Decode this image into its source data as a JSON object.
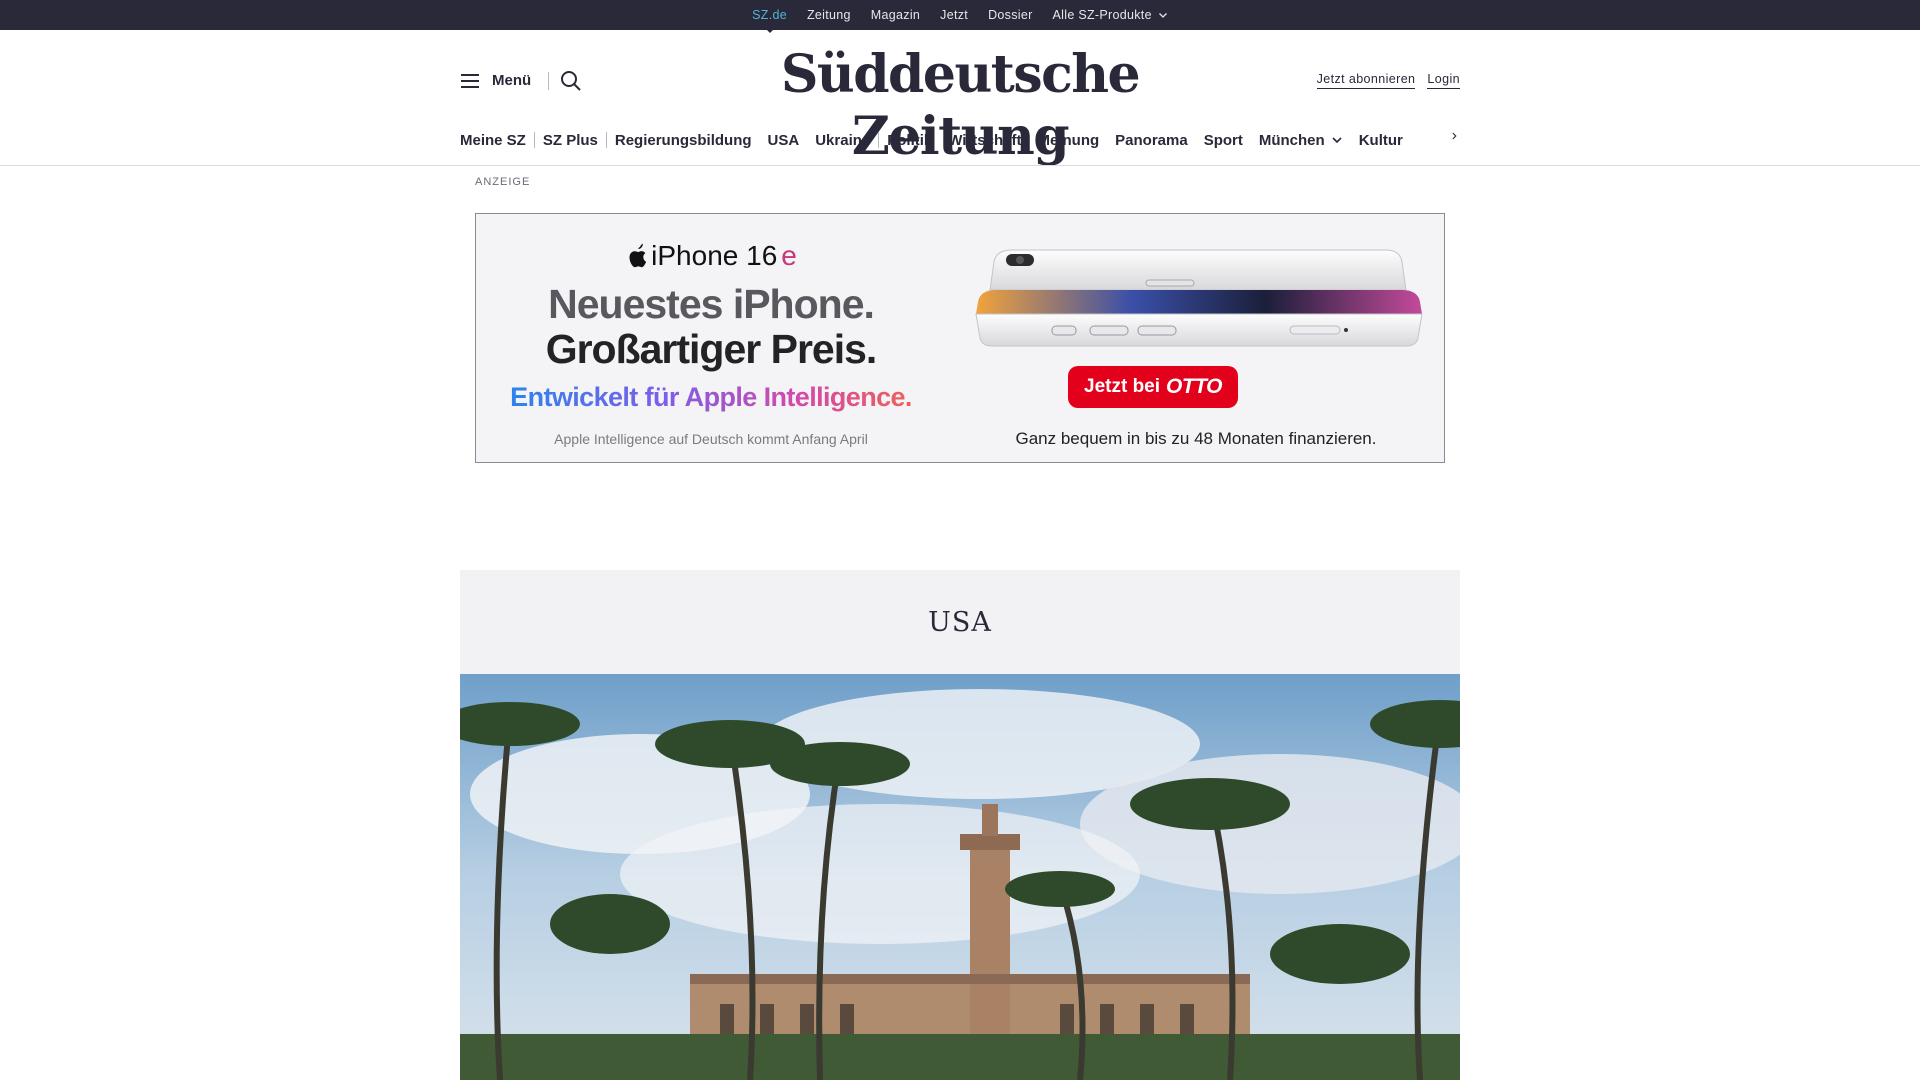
{
  "topbar": {
    "links": [
      "SZ.de",
      "Zeitung",
      "Magazin",
      "Jetzt",
      "Dossier",
      "Alle SZ-Produkte"
    ]
  },
  "header": {
    "menu_label": "Menü",
    "logo": "Süddeutsche Zeitung",
    "subscribe": "Jetzt abonnieren",
    "login": "Login"
  },
  "nav": {
    "items": [
      "Meine SZ",
      "SZ Plus",
      "Regierungsbildung",
      "USA",
      "Ukraine",
      "Politik",
      "Wirtschaft",
      "Meinung",
      "Panorama",
      "Sport",
      "München",
      "Kultur"
    ]
  },
  "ad": {
    "label": "ANZEIGE",
    "product": "iPhone 16",
    "product_suffix": "e",
    "headline_1": "Neuestes iPhone.",
    "headline_2": "Großartiger Preis.",
    "intelligence": "Entwickelt für Apple Intelligence.",
    "note": "Apple Intelligence auf Deutsch kommt Anfang April",
    "cta_prefix": "Jetzt bei",
    "cta_brand": "OTTO",
    "finance": "Ganz bequem in bis zu 48 Monaten finanzieren."
  },
  "section": {
    "title": "USA"
  },
  "colors": {
    "topbar_bg": "#29293a",
    "active_link": "#55b3d8",
    "cta_red": "#e3001b",
    "section_bg": "#f2f2f4"
  }
}
